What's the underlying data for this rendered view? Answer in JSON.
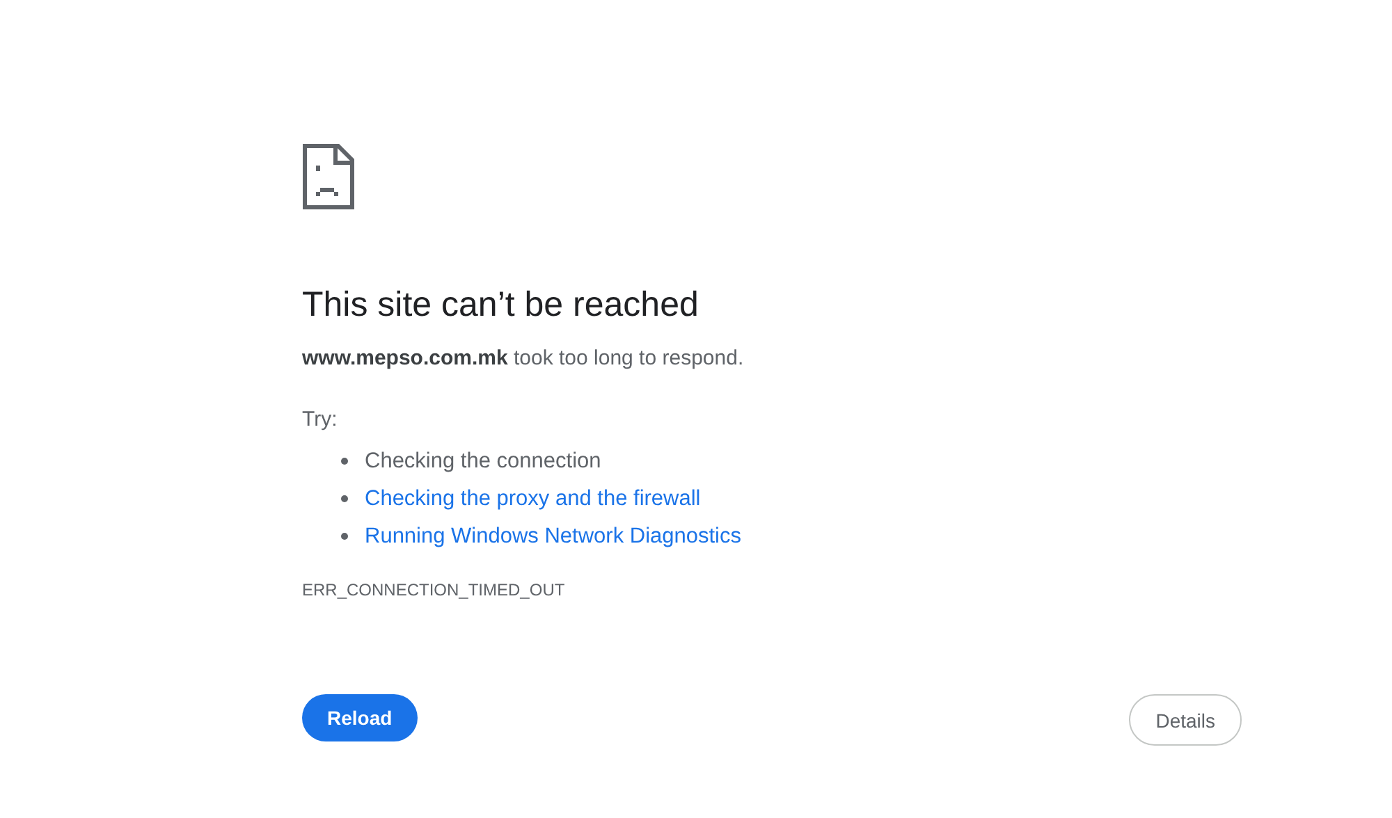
{
  "error_page": {
    "title": "This site can’t be reached",
    "message": "**www.mepso.com.mk** took too long to respond.",
    "try_label": "Try:",
    "suggestions": [
      {
        "kind": "text",
        "label": "Checking the connection"
      },
      {
        "kind": "link",
        "label": "Checking the proxy and the firewall"
      },
      {
        "kind": "link",
        "label": "Running Windows Network Diagnostics"
      }
    ],
    "error_code": "ERR_CONNECTION_TIMED_OUT",
    "buttons": {
      "primary": "Reload",
      "secondary": "Details"
    }
  }
}
